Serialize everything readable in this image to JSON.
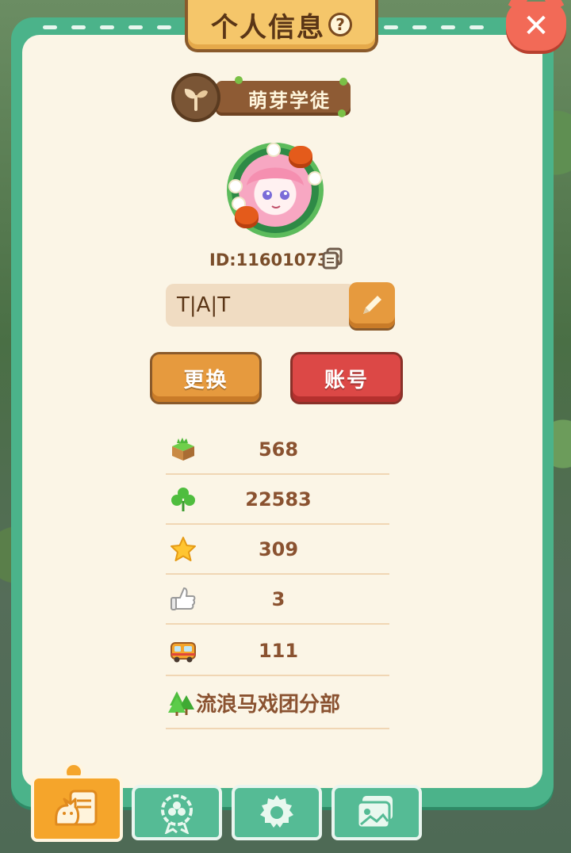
{
  "dialog": {
    "title": "个人信息",
    "help_glyph": "?",
    "close_glyph": "✕"
  },
  "profile": {
    "rank_title": "萌芽学徒",
    "id_text": "ID:116010738",
    "name": "T|A|T"
  },
  "buttons": {
    "change_label": "更换",
    "account_label": "账号"
  },
  "stats": [
    {
      "icon": "grass-block-icon",
      "value": "568"
    },
    {
      "icon": "clover-icon",
      "value": "22583"
    },
    {
      "icon": "star-icon",
      "value": "309"
    },
    {
      "icon": "thumbs-up-icon",
      "value": "3"
    },
    {
      "icon": "bus-icon",
      "value": "111"
    }
  ],
  "guild": {
    "icon": "tree-icon",
    "name": "流浪马戏团分部"
  },
  "tabs": [
    {
      "icon": "cat-card-icon",
      "active": true
    },
    {
      "icon": "clover-badge-icon",
      "active": false
    },
    {
      "icon": "gear-icon",
      "active": false
    },
    {
      "icon": "photo-album-icon",
      "active": false
    }
  ],
  "colors": {
    "panel_green": "#4bb38a",
    "panel_cream": "#fbf5e6",
    "accent_orange": "#e69a3e",
    "accent_red": "#dc4846",
    "text_brown": "#8a5230"
  }
}
